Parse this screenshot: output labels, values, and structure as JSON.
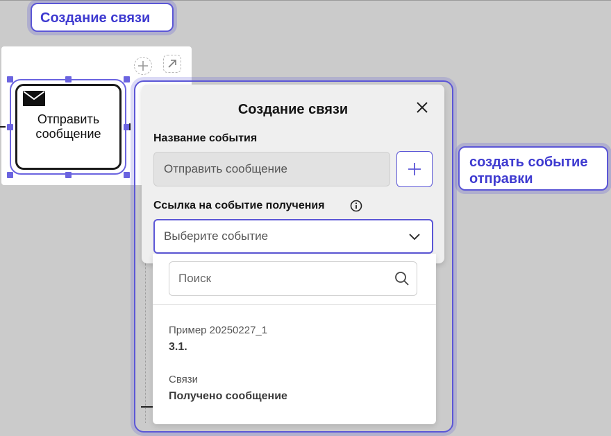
{
  "callouts": {
    "top": "Создание связи",
    "right_line1": "создать событие",
    "right_line2": "отправки"
  },
  "canvas": {
    "task": {
      "line1": "Отправить",
      "line2": "сообщение",
      "icon": "envelope-icon"
    },
    "context_pad": [
      "plus-icon",
      "arrow-up-right-icon"
    ]
  },
  "dialog": {
    "title": "Создание связи",
    "event_name_label": "Название события",
    "event_name_value": "Отправить сообщение",
    "receive_link_label": "Ссылка на событие получения",
    "select_placeholder": "Выберите событие",
    "search_placeholder": "Поиск",
    "groups": [
      {
        "group": "Пример 20250227_1",
        "item": "3.1."
      },
      {
        "group": "Связи",
        "item": "Получено сообщение"
      }
    ]
  },
  "colors": {
    "accent": "#5b56d6",
    "callout_text": "#3e3ad0",
    "background": "#cbcbcb"
  }
}
